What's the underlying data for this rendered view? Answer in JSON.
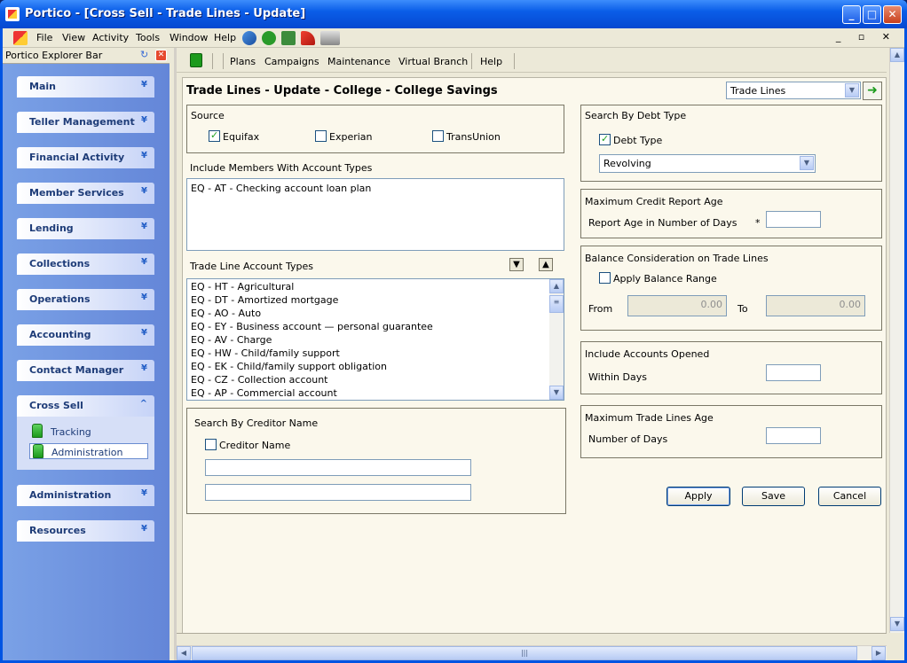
{
  "window": {
    "title": "Portico - [Cross Sell - Trade Lines - Update]",
    "minimize": "_",
    "maximize": "□",
    "close": "✕"
  },
  "menubar": {
    "items": [
      "File",
      "View",
      "Activity",
      "Tools",
      "Window",
      "Help"
    ],
    "mdi_controls": "_ ▫ ✕"
  },
  "explorer": {
    "title": "Portico Explorer Bar",
    "sections": [
      "Main",
      "Teller Management",
      "Financial Activity",
      "Member Services",
      "Lending",
      "Collections",
      "Operations",
      "Accounting",
      "Contact Manager",
      "Cross Sell",
      "Administration",
      "Resources"
    ],
    "cross_sell_items": [
      "Tracking",
      "Administration"
    ],
    "selected_item": "Administration"
  },
  "navbar": {
    "links": [
      "Plans",
      "Campaigns",
      "Maintenance",
      "Virtual Branch",
      "Help"
    ]
  },
  "form": {
    "heading": "Trade Lines - Update - College - College Savings",
    "view_select": "Trade Lines",
    "source": {
      "title": "Source",
      "equifax": "Equifax",
      "experian": "Experian",
      "transunion": "TransUnion"
    },
    "include_members": {
      "title": "Include Members With Account Types",
      "items": [
        "EQ - AT - Checking account loan plan"
      ]
    },
    "trade_line_types": {
      "title": "Trade Line Account Types",
      "items": [
        "EQ - HT - Agricultural",
        "EQ - DT - Amortized mortgage",
        "EQ - AO - Auto",
        "EQ - EY - Business account — personal guarantee",
        "EQ - AV - Charge",
        "EQ - HW - Child/family support",
        "EQ - EK - Child/family support obligation",
        "EQ - CZ - Collection account",
        "EQ - AP - Commercial account"
      ]
    },
    "creditor": {
      "title": "Search By Creditor Name",
      "checkbox": "Creditor Name"
    },
    "debt_type": {
      "title": "Search By Debt Type",
      "checkbox": "Debt Type",
      "value": "Revolving"
    },
    "credit_age": {
      "title": "Maximum Credit Report Age",
      "label": "Report Age in Number of Days",
      "required": "*"
    },
    "balance": {
      "title": "Balance Consideration on Trade Lines",
      "checkbox": "Apply Balance Range",
      "from_label": "From",
      "from_value": "0.00",
      "to_label": "To",
      "to_value": "0.00"
    },
    "opened": {
      "title": "Include Accounts Opened",
      "label": "Within Days"
    },
    "trade_age": {
      "title": "Maximum Trade Lines Age",
      "label": "Number of Days"
    },
    "buttons": {
      "apply": "Apply",
      "save": "Save",
      "cancel": "Cancel"
    }
  }
}
